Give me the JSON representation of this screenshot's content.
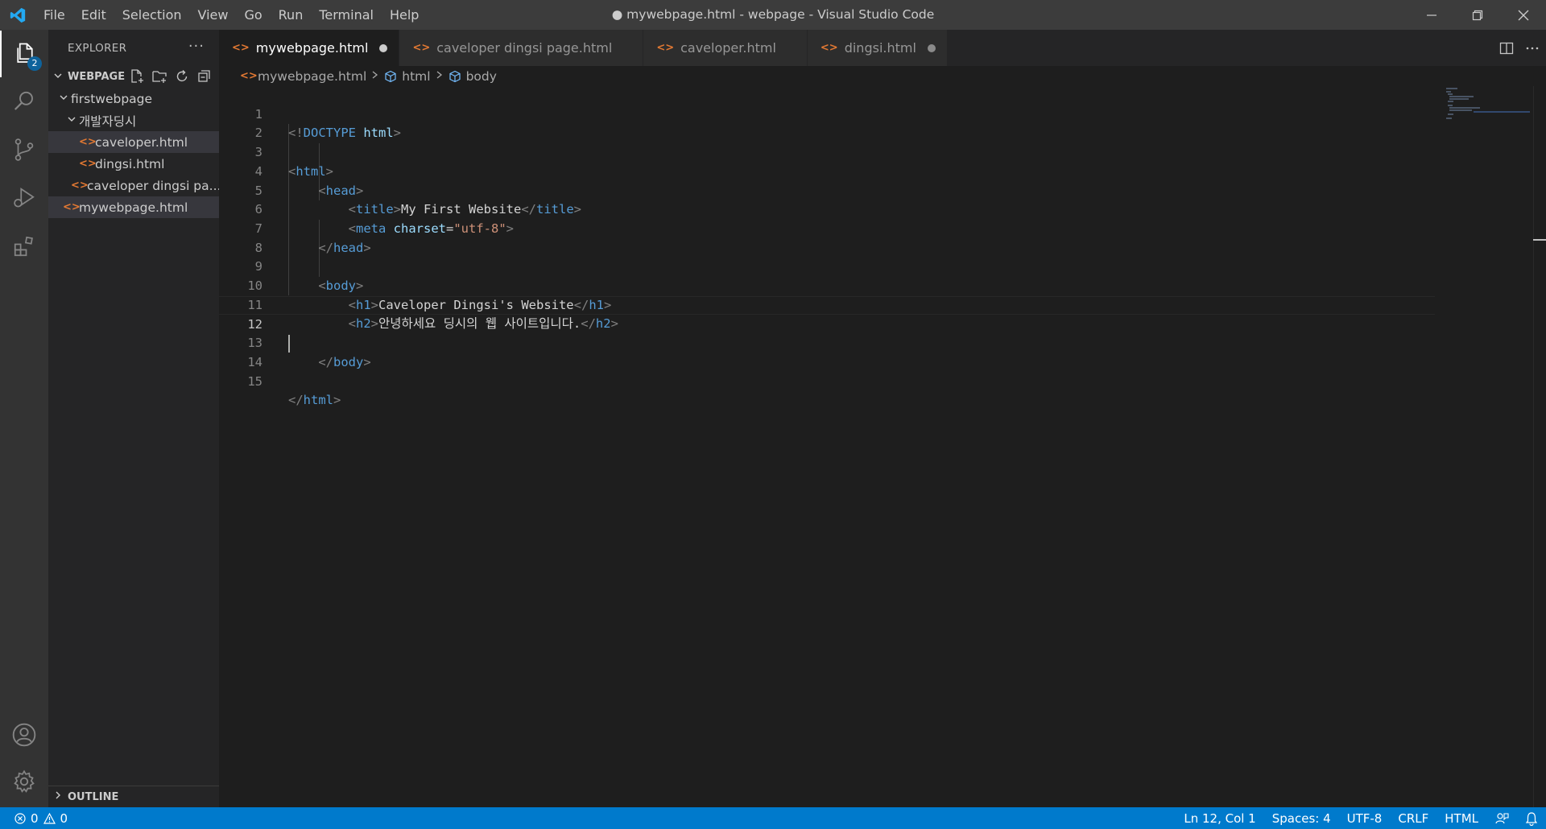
{
  "window": {
    "title": "● mywebpage.html - webpage - Visual Studio Code"
  },
  "menu": [
    "File",
    "Edit",
    "Selection",
    "View",
    "Go",
    "Run",
    "Terminal",
    "Help"
  ],
  "activity": {
    "explorer_badge": "2"
  },
  "sidebar": {
    "header": "EXPLORER",
    "more": "···",
    "workspace": "WEBPAGE",
    "tree": [
      {
        "label": "firstwebpage",
        "type": "folder"
      },
      {
        "label": "개발자딩시",
        "type": "folder"
      },
      {
        "label": "caveloper.html",
        "type": "file"
      },
      {
        "label": "dingsi.html",
        "type": "file"
      },
      {
        "label": "caveloper dingsi pa...",
        "type": "file"
      },
      {
        "label": "mywebpage.html",
        "type": "file"
      }
    ],
    "outline": "OUTLINE"
  },
  "tabs": [
    {
      "label": "mywebpage.html",
      "active": true,
      "dirty": true
    },
    {
      "label": "caveloper dingsi page.html",
      "active": false,
      "dirty": false
    },
    {
      "label": "caveloper.html",
      "active": false,
      "dirty": false
    },
    {
      "label": "dingsi.html",
      "active": false,
      "dirty": true
    }
  ],
  "breadcrumb": {
    "file": "mywebpage.html",
    "html": "html",
    "body": "body"
  },
  "editor": {
    "current_line": 12,
    "line_numbers": [
      "1",
      "2",
      "3",
      "4",
      "5",
      "6",
      "7",
      "8",
      "9",
      "10",
      "11",
      "12",
      "13",
      "14",
      "15"
    ],
    "tokens": {
      "l1_open": "<!",
      "l1_doctype": "DOCTYPE",
      "l1_html": "html",
      "l1_close": ">",
      "html_tag": "html",
      "head_tag": "head",
      "title_tag": "title",
      "title_text": "My First Website",
      "meta_tag": "meta",
      "charset_attr": "charset",
      "equals": "=",
      "charset_value": "\"utf-8\"",
      "body_tag": "body",
      "h1_tag": "h1",
      "h1_text": "Caveloper Dingsi's Website",
      "h2_tag": "h2",
      "h2_text": "안녕하세요 딩시의 웹 사이트입니다."
    }
  },
  "status": {
    "errors": "0",
    "warnings": "0",
    "position": "Ln 12, Col 1",
    "spaces": "Spaces: 4",
    "encoding": "UTF-8",
    "eol": "CRLF",
    "language": "HTML"
  },
  "colors": {
    "status_bar": "#007acc",
    "file_icon": "#e37933",
    "tag": "#569cd6",
    "attr": "#9cdcfe",
    "string": "#ce9178"
  }
}
